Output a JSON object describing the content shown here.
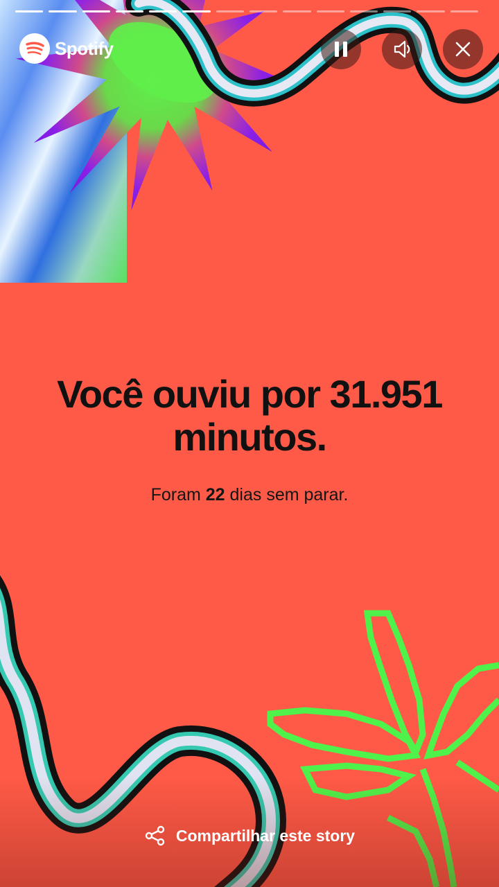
{
  "story": {
    "progress_segments_total": 14,
    "progress_segments_done": 6,
    "background_color": "#ff5a47"
  },
  "header": {
    "brand_name": "Spotify",
    "controls": {
      "pause_icon": "pause-icon",
      "volume_icon": "volume-icon",
      "close_icon": "close-icon"
    }
  },
  "content": {
    "headline": "Você ouviu por 31.951 minutos.",
    "subtitle_prefix": "Foram ",
    "subtitle_days": "22",
    "subtitle_suffix": " dias sem parar."
  },
  "footer": {
    "share_label": "Compartilhar este story",
    "share_icon": "share-icon"
  }
}
